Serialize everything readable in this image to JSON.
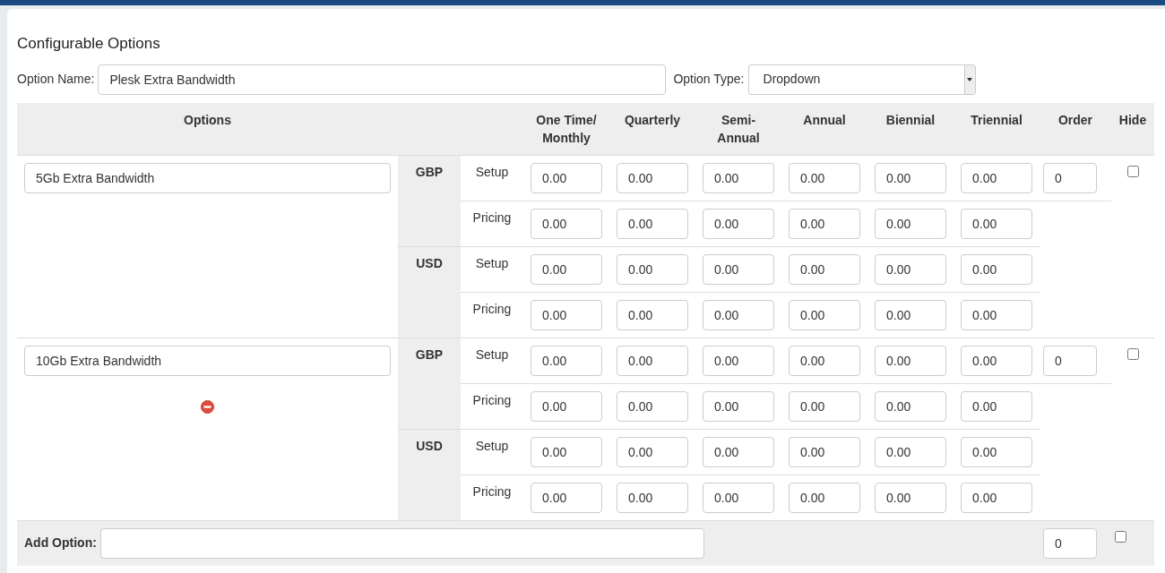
{
  "title": "Configurable Options",
  "option_name": {
    "label": "Option Name:",
    "value": "Plesk Extra Bandwidth"
  },
  "option_type": {
    "label": "Option Type:",
    "value": "Dropdown"
  },
  "table": {
    "columns": [
      "Options",
      "One Time/ Monthly",
      "Quarterly",
      "Semi- Annual",
      "Annual",
      "Biennial",
      "Triennial",
      "Order",
      "Hide"
    ],
    "options": [
      {
        "name": "5Gb Extra Bandwidth",
        "removable": false,
        "order": "0",
        "hidden": false,
        "currencies": [
          {
            "code": "GBP",
            "rows": [
              {
                "label": "Setup",
                "values": [
                  "0.00",
                  "0.00",
                  "0.00",
                  "0.00",
                  "0.00",
                  "0.00"
                ]
              },
              {
                "label": "Pricing",
                "values": [
                  "0.00",
                  "0.00",
                  "0.00",
                  "0.00",
                  "0.00",
                  "0.00"
                ]
              }
            ]
          },
          {
            "code": "USD",
            "rows": [
              {
                "label": "Setup",
                "values": [
                  "0.00",
                  "0.00",
                  "0.00",
                  "0.00",
                  "0.00",
                  "0.00"
                ]
              },
              {
                "label": "Pricing",
                "values": [
                  "0.00",
                  "0.00",
                  "0.00",
                  "0.00",
                  "0.00",
                  "0.00"
                ]
              }
            ]
          }
        ]
      },
      {
        "name": "10Gb Extra Bandwidth",
        "removable": true,
        "order": "0",
        "hidden": false,
        "currencies": [
          {
            "code": "GBP",
            "rows": [
              {
                "label": "Setup",
                "values": [
                  "0.00",
                  "0.00",
                  "0.00",
                  "0.00",
                  "0.00",
                  "0.00"
                ]
              },
              {
                "label": "Pricing",
                "values": [
                  "0.00",
                  "0.00",
                  "0.00",
                  "0.00",
                  "0.00",
                  "0.00"
                ]
              }
            ]
          },
          {
            "code": "USD",
            "rows": [
              {
                "label": "Setup",
                "values": [
                  "0.00",
                  "0.00",
                  "0.00",
                  "0.00",
                  "0.00",
                  "0.00"
                ]
              },
              {
                "label": "Pricing",
                "values": [
                  "0.00",
                  "0.00",
                  "0.00",
                  "0.00",
                  "0.00",
                  "0.00"
                ]
              }
            ]
          }
        ]
      }
    ],
    "add_option": {
      "label": "Add Option:",
      "order": "0",
      "hidden": false
    }
  }
}
